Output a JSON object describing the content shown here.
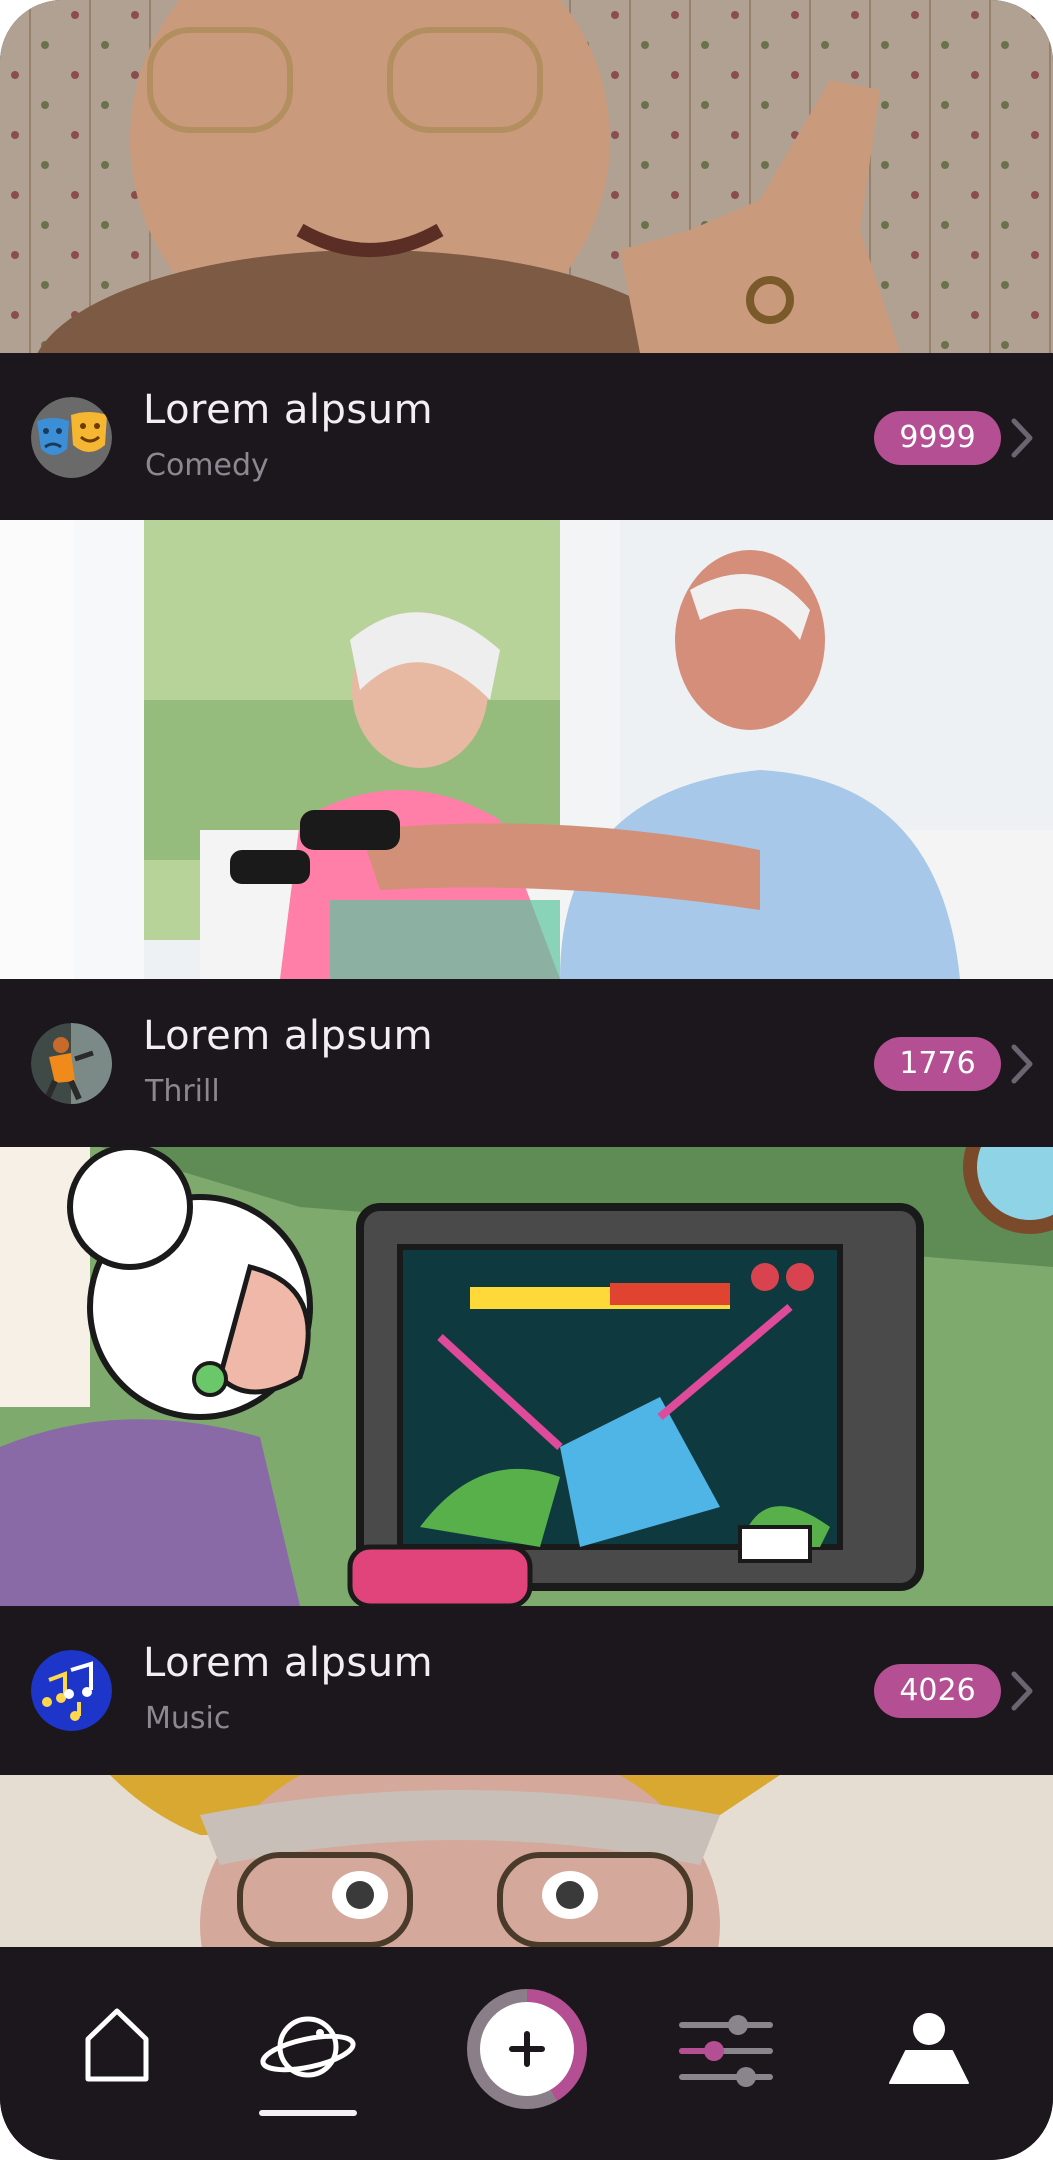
{
  "feed": [
    {
      "title": "Lorem alpsum",
      "genre": "Comedy",
      "count": "9999",
      "avatar_icon": "theater-masks-icon"
    },
    {
      "title": "Lorem alpsum",
      "genre": "Thrill",
      "count": "1776",
      "avatar_icon": "thrill-person-icon"
    },
    {
      "title": "Lorem alpsum",
      "genre": "Music",
      "count": "4026",
      "avatar_icon": "music-notes-icon"
    }
  ],
  "nav": {
    "items": [
      "home-icon",
      "planet-icon",
      "add-icon",
      "filter-sliders-icon",
      "profile-icon"
    ],
    "active": "planet-icon"
  },
  "colors": {
    "background": "#1b171c",
    "accent": "#b34f92",
    "text_primary": "#f2eef2",
    "text_secondary": "#8e8690"
  }
}
